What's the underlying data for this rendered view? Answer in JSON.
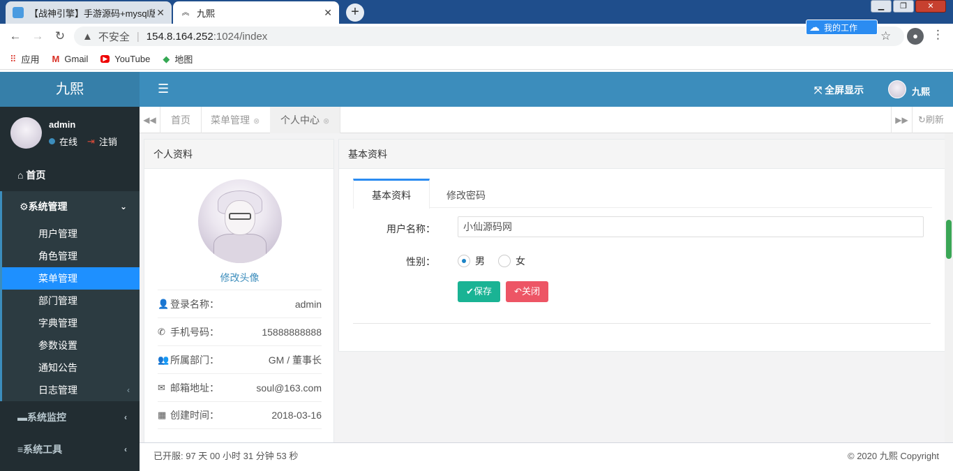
{
  "browser": {
    "tabs": [
      {
        "title": "【战神引擎】手游源码+mysql版",
        "close": "✕"
      },
      {
        "title": "九熙",
        "close": "✕"
      }
    ],
    "new_tab": "+",
    "window_controls": {
      "minimize": "▁",
      "maximize": "❐",
      "close": "✕"
    },
    "address": {
      "insecure": "不安全",
      "host": "154.8.164.252",
      "path": ":1024/index"
    },
    "extension_label": "我的工作",
    "bookmarks": [
      {
        "label": "应用",
        "icon": "apps-grid-icon"
      },
      {
        "label": "Gmail",
        "icon": "gmail-icon"
      },
      {
        "label": "YouTube",
        "icon": "youtube-icon"
      },
      {
        "label": "地图",
        "icon": "maps-icon"
      }
    ]
  },
  "header": {
    "logo": "九熙",
    "fullscreen": "全屏显示",
    "user": "九熙"
  },
  "sidebar": {
    "username": "admin",
    "status": "在线",
    "logout": "注销",
    "home": "首页",
    "system": "系统管理",
    "submenu": [
      "用户管理",
      "角色管理",
      "菜单管理",
      "部门管理",
      "字典管理",
      "参数设置",
      "通知公告",
      "日志管理"
    ],
    "monitor": "系统监控",
    "tools": "系统工具"
  },
  "content_tabs": {
    "tabs": [
      "首页",
      "菜单管理",
      "个人中心"
    ],
    "refresh": "刷新"
  },
  "profile": {
    "title": "个人资料",
    "change_avatar": "修改头像",
    "rows": [
      {
        "label": "登录名称：",
        "value": "admin"
      },
      {
        "label": "手机号码：",
        "value": "15888888888"
      },
      {
        "label": "所属部门：",
        "value": "GM / 董事长"
      },
      {
        "label": "邮箱地址：",
        "value": "soul@163.com"
      },
      {
        "label": "创建时间：",
        "value": "2018-03-16"
      }
    ]
  },
  "basic": {
    "title": "基本资料",
    "tabs": [
      "基本资料",
      "修改密码"
    ],
    "username_label": "用户名称：",
    "username_value": "小仙源码网",
    "gender_label": "性别：",
    "gender_options": [
      "男",
      "女"
    ],
    "gender_selected": "男",
    "save": "保存",
    "close": "关闭"
  },
  "footer": {
    "uptime": "已开服: 97 天 00 小时 31 分钟 53 秒",
    "copyright": "© 2020 九熙 Copyright"
  },
  "colors": {
    "header": "#3c8dbc",
    "sidebar": "#222d32",
    "active_menu": "#1e90ff",
    "save": "#1ab394",
    "close": "#ed5565"
  }
}
